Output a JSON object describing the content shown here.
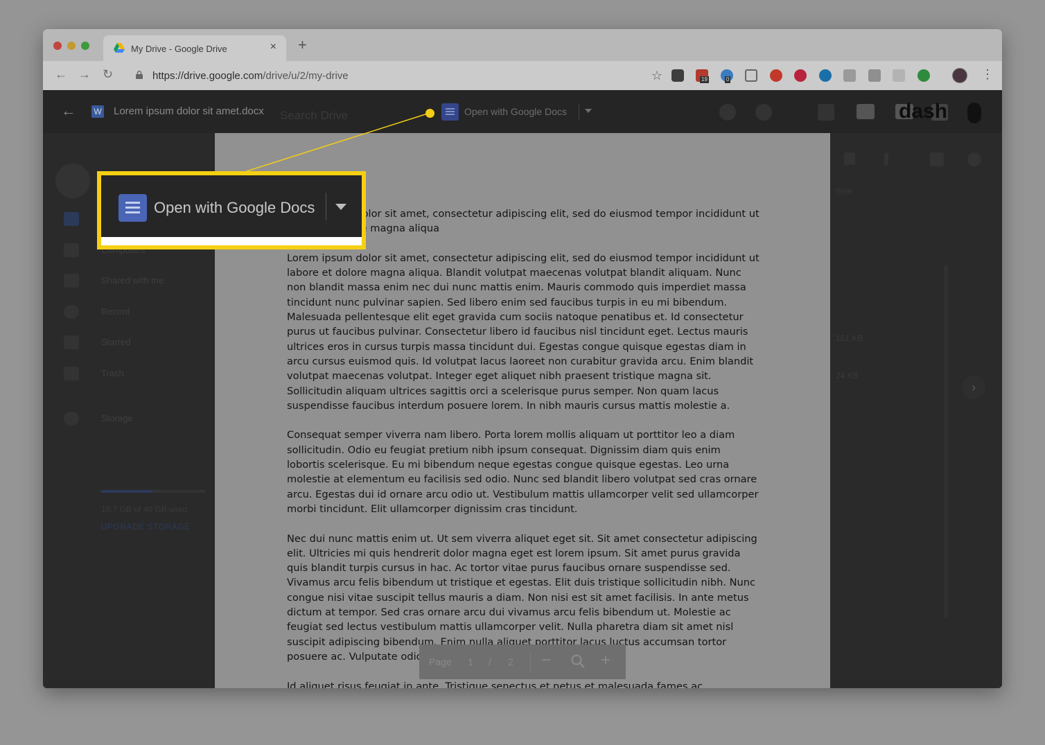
{
  "browser": {
    "tab_title": "My Drive - Google Drive",
    "tab_close": "×",
    "new_tab": "+",
    "url_host": "https://drive.google.com",
    "url_path": "/drive/u/2/my-drive",
    "ext_badge_1": "19",
    "ext_badge_2": "0",
    "menu": "⋮",
    "back": "←",
    "forward": "→",
    "reload": "↻",
    "star": "☆"
  },
  "viewer": {
    "back": "←",
    "word_icon": "W",
    "file_name": "Lorem ipsum dolor sit amet.docx",
    "search_text": "Search Drive",
    "open_with_label": "Open with Google Docs"
  },
  "sidebar": {
    "items": [
      {
        "label": "Computers"
      },
      {
        "label": "Shared with me"
      },
      {
        "label": "Recent"
      },
      {
        "label": "Starred"
      },
      {
        "label": "Trash"
      }
    ],
    "storage_label": "Storage",
    "storage_text": "19.7 GB of 40 GB used",
    "storage_fraction": 0.49,
    "upgrade_label": "UPGRADE STORAGE"
  },
  "right_panel": {
    "size_header": "Size",
    "sizes": [
      "161 KB",
      "24 KB"
    ],
    "logo_text": "dash",
    "next": "›"
  },
  "document": {
    "first_paragraph": "Lorem ipsum dolor sit amet, consectetur adipiscing elit, sed do eiusmod tempor incididunt ut labore et dolore magna aliqua",
    "paragraphs": [
      "Lorem ipsum dolor sit amet, consectetur adipiscing elit, sed do eiusmod tempor incididunt ut labore et dolore magna aliqua. Blandit volutpat maecenas volutpat blandit aliquam. Nunc non blandit massa enim nec dui nunc mattis enim. Mauris commodo quis imperdiet massa tincidunt nunc pulvinar sapien. Sed libero enim sed faucibus turpis in eu mi bibendum. Malesuada pellentesque elit eget gravida cum sociis natoque penatibus et. Id consectetur purus ut faucibus pulvinar. Consectetur libero id faucibus nisl tincidunt eget. Lectus mauris ultrices eros in cursus turpis massa tincidunt dui. Egestas congue quisque egestas diam in arcu cursus euismod quis. Id volutpat lacus laoreet non curabitur gravida arcu. Enim blandit volutpat maecenas volutpat. Integer eget aliquet nibh praesent tristique magna sit. Sollicitudin aliquam ultrices sagittis orci a scelerisque purus semper. Non quam lacus suspendisse faucibus interdum posuere lorem. In nibh mauris cursus mattis molestie a.",
      "Consequat semper viverra nam libero. Porta lorem mollis aliquam ut porttitor leo a diam sollicitudin. Odio eu feugiat pretium nibh ipsum consequat. Dignissim diam quis enim lobortis scelerisque. Eu mi bibendum neque egestas congue quisque egestas. Leo urna molestie at elementum eu facilisis sed odio. Nunc sed blandit libero volutpat sed cras ornare arcu. Egestas dui id ornare arcu odio ut. Vestibulum mattis ullamcorper velit sed ullamcorper morbi tincidunt. Elit ullamcorper dignissim cras tincidunt.",
      "Nec dui nunc mattis enim ut. Ut sem viverra aliquet eget sit. Sit amet consectetur adipiscing elit. Ultricies mi quis hendrerit dolor magna eget est lorem ipsum. Sit amet purus gravida quis blandit turpis cursus in hac. Ac tortor vitae purus faucibus ornare suspendisse sed. Vivamus arcu felis bibendum ut tristique et egestas. Elit duis tristique sollicitudin nibh. Nunc congue nisi vitae suscipit tellus mauris a diam. Non nisi est sit amet facilisis. In ante metus dictum at tempor. Sed cras ornare arcu dui vivamus arcu felis bibendum ut. Molestie ac feugiat sed lectus vestibulum mattis ullamcorper velit. Nulla pharetra diam sit amet nisl suscipit adipiscing bibendum. Enim nulla aliquet porttitor lacus luctus accumsan tortor posuere ac. Vulputate odio ut enim blandit volutpat.",
      "Id aliquet risus feugiat in ante. Tristique senectus et netus et malesuada fames ac. Consequat id"
    ]
  },
  "page_controls": {
    "page_label": "Page",
    "current": "1",
    "separator": "/",
    "total": "2",
    "zoom_out": "−",
    "zoom_in": "+"
  },
  "callout": {
    "label": "Open with Google Docs",
    "highlight_color": "#f5cf14"
  },
  "colors": {
    "accent_yellow": "#f5cf14",
    "docs_blue": "#4a64b6"
  }
}
